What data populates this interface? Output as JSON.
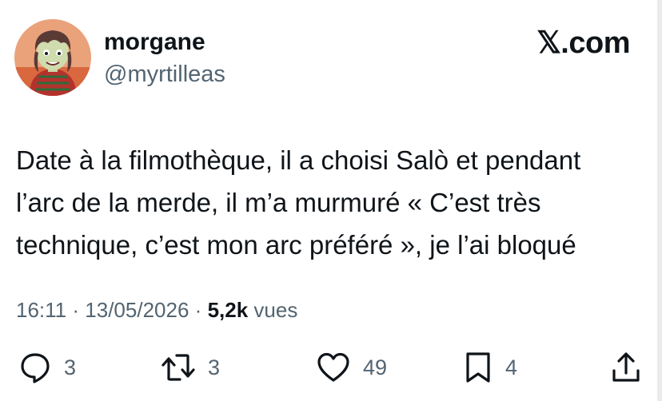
{
  "author": {
    "display_name": "morgane",
    "handle": "@myrtilleas",
    "avatar_icon": "cartoon-avatar-icon"
  },
  "brand": {
    "label": "𝕏.com"
  },
  "tweet": {
    "text": "Date à la filmothèque, il a choisi Salò et pendant\nl’arc de la merde, il m’a murmuré « C’est très\ntechnique, c’est mon arc préféré », je l’ai bloqué"
  },
  "meta": {
    "time": "16:11",
    "separator": "·",
    "date": "13/05/2026",
    "views_count": "5,2k",
    "views_label": "vues"
  },
  "actions": {
    "replies": {
      "icon": "reply-icon",
      "count": "3"
    },
    "reposts": {
      "icon": "repost-icon",
      "count": "3"
    },
    "likes": {
      "icon": "heart-icon",
      "count": "49"
    },
    "bookmarks": {
      "icon": "bookmark-icon",
      "count": "4"
    },
    "share": {
      "icon": "share-icon"
    }
  },
  "colors": {
    "text_primary": "#0f1419",
    "text_secondary": "#536471",
    "background": "#ffffff"
  }
}
